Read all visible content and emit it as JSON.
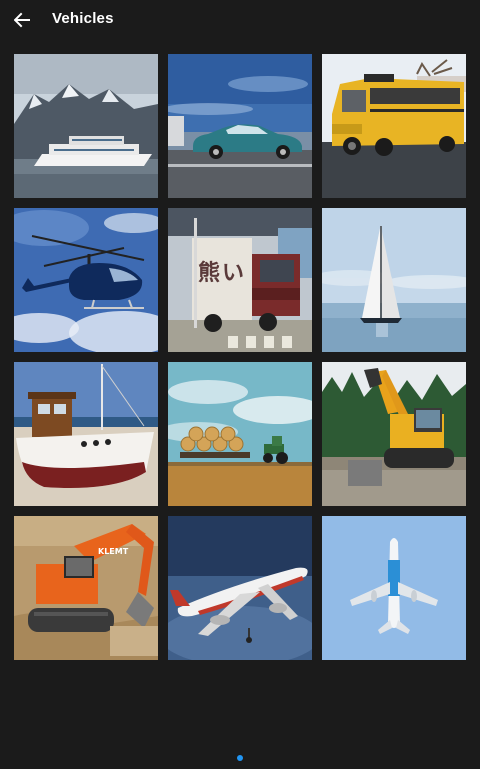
{
  "header": {
    "back_icon": "arrow-left-icon",
    "title": "Vehicles"
  },
  "gallery": {
    "items": [
      {
        "subject": "cruise ship"
      },
      {
        "subject": "classic car"
      },
      {
        "subject": "school bus"
      },
      {
        "subject": "helicopter"
      },
      {
        "subject": "truck"
      },
      {
        "subject": "sailboat"
      },
      {
        "subject": "fishing boat"
      },
      {
        "subject": "tractor"
      },
      {
        "subject": "excavator"
      },
      {
        "subject": "excavator"
      },
      {
        "subject": "airliner"
      },
      {
        "subject": "airplane"
      }
    ]
  },
  "pager": {
    "active_color": "#2196f3"
  }
}
